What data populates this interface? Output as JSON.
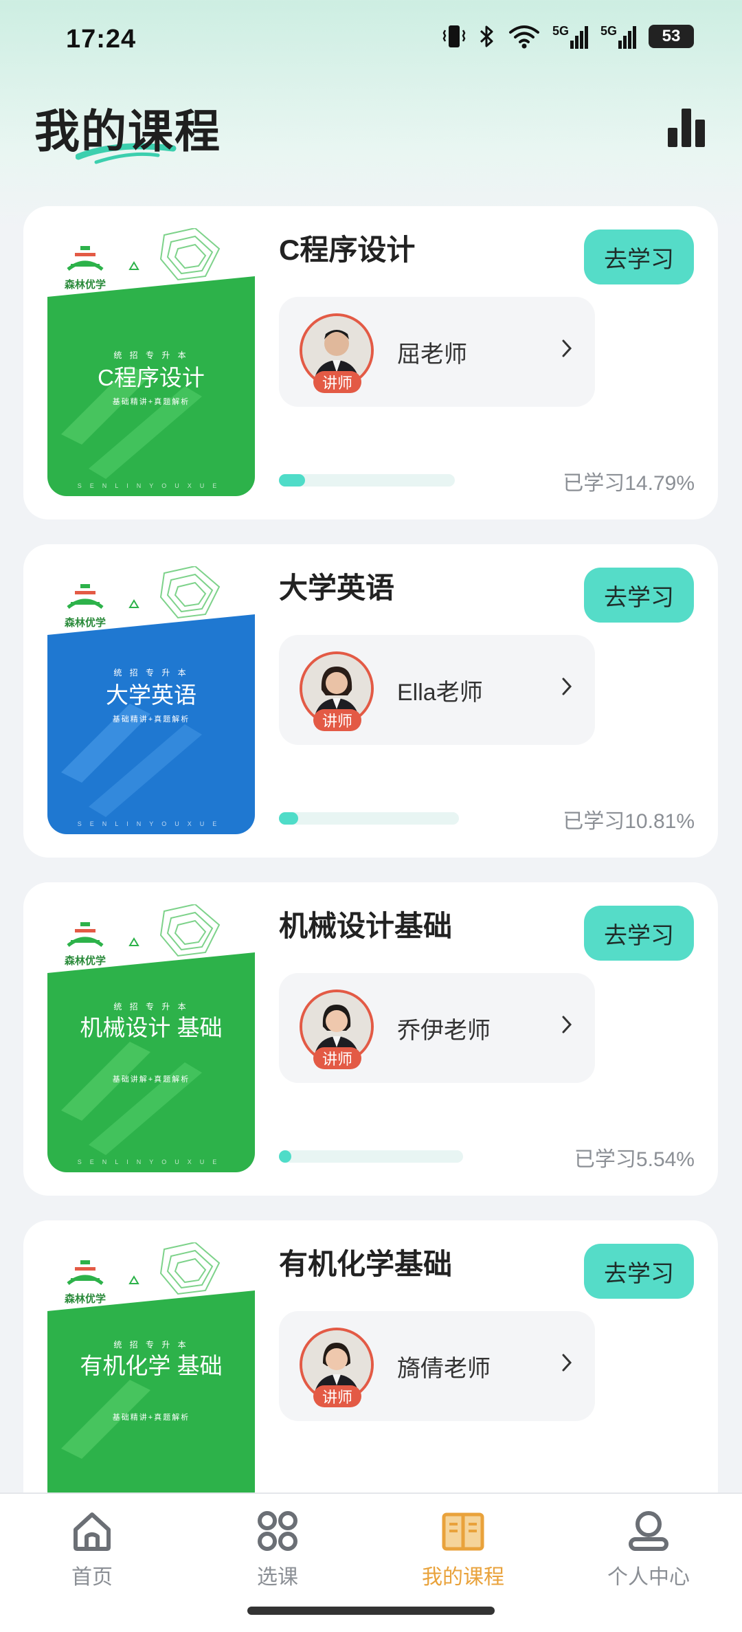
{
  "status_bar": {
    "time": "17:24",
    "signal_1": "5G",
    "signal_2": "5G",
    "battery": "53"
  },
  "header": {
    "title": "我的课程"
  },
  "courses": [
    {
      "name": "C程序设计",
      "cover_title": "C程序设计",
      "cover_subtitle": "统 招 专 升 本",
      "cover_tagline": "基础精讲+真题解析",
      "cover_color": "#2db24a",
      "teacher": "屈老师",
      "teacher_badge": "讲师",
      "button": "去学习",
      "progress_percent": 14.79,
      "progress_label": "已学习14.79%"
    },
    {
      "name": "大学英语",
      "cover_title": "大学英语",
      "cover_subtitle": "统 招 专 升 本",
      "cover_tagline": "基础精讲+真题解析",
      "cover_color": "#1f78d1",
      "teacher": "Ella老师",
      "teacher_badge": "讲师",
      "button": "去学习",
      "progress_percent": 10.81,
      "progress_label": "已学习10.81%"
    },
    {
      "name": "机械设计基础",
      "cover_title": "机械设计 基础",
      "cover_subtitle": "统 招 专 升 本",
      "cover_tagline": "基础讲解+真题解析",
      "cover_color": "#2db24a",
      "teacher": "乔伊老师",
      "teacher_badge": "讲师",
      "button": "去学习",
      "progress_percent": 5.54,
      "progress_label": "已学习5.54%"
    },
    {
      "name": "有机化学基础",
      "cover_title": "有机化学 基础",
      "cover_subtitle": "统 招 专 升 本",
      "cover_tagline": "基础精讲+真题解析",
      "cover_color": "#2db24a",
      "teacher": "旖倩老师",
      "teacher_badge": "讲师",
      "button": "去学习",
      "progress_percent": null,
      "progress_label": ""
    }
  ],
  "cover_brand": "森林优学",
  "bottom_nav": {
    "items": [
      {
        "label": "首页",
        "icon": "home-icon"
      },
      {
        "label": "选课",
        "icon": "grid-icon"
      },
      {
        "label": "我的课程",
        "icon": "book-icon",
        "active": true
      },
      {
        "label": "个人中心",
        "icon": "user-icon"
      }
    ],
    "active_color": "#e9a23b"
  }
}
